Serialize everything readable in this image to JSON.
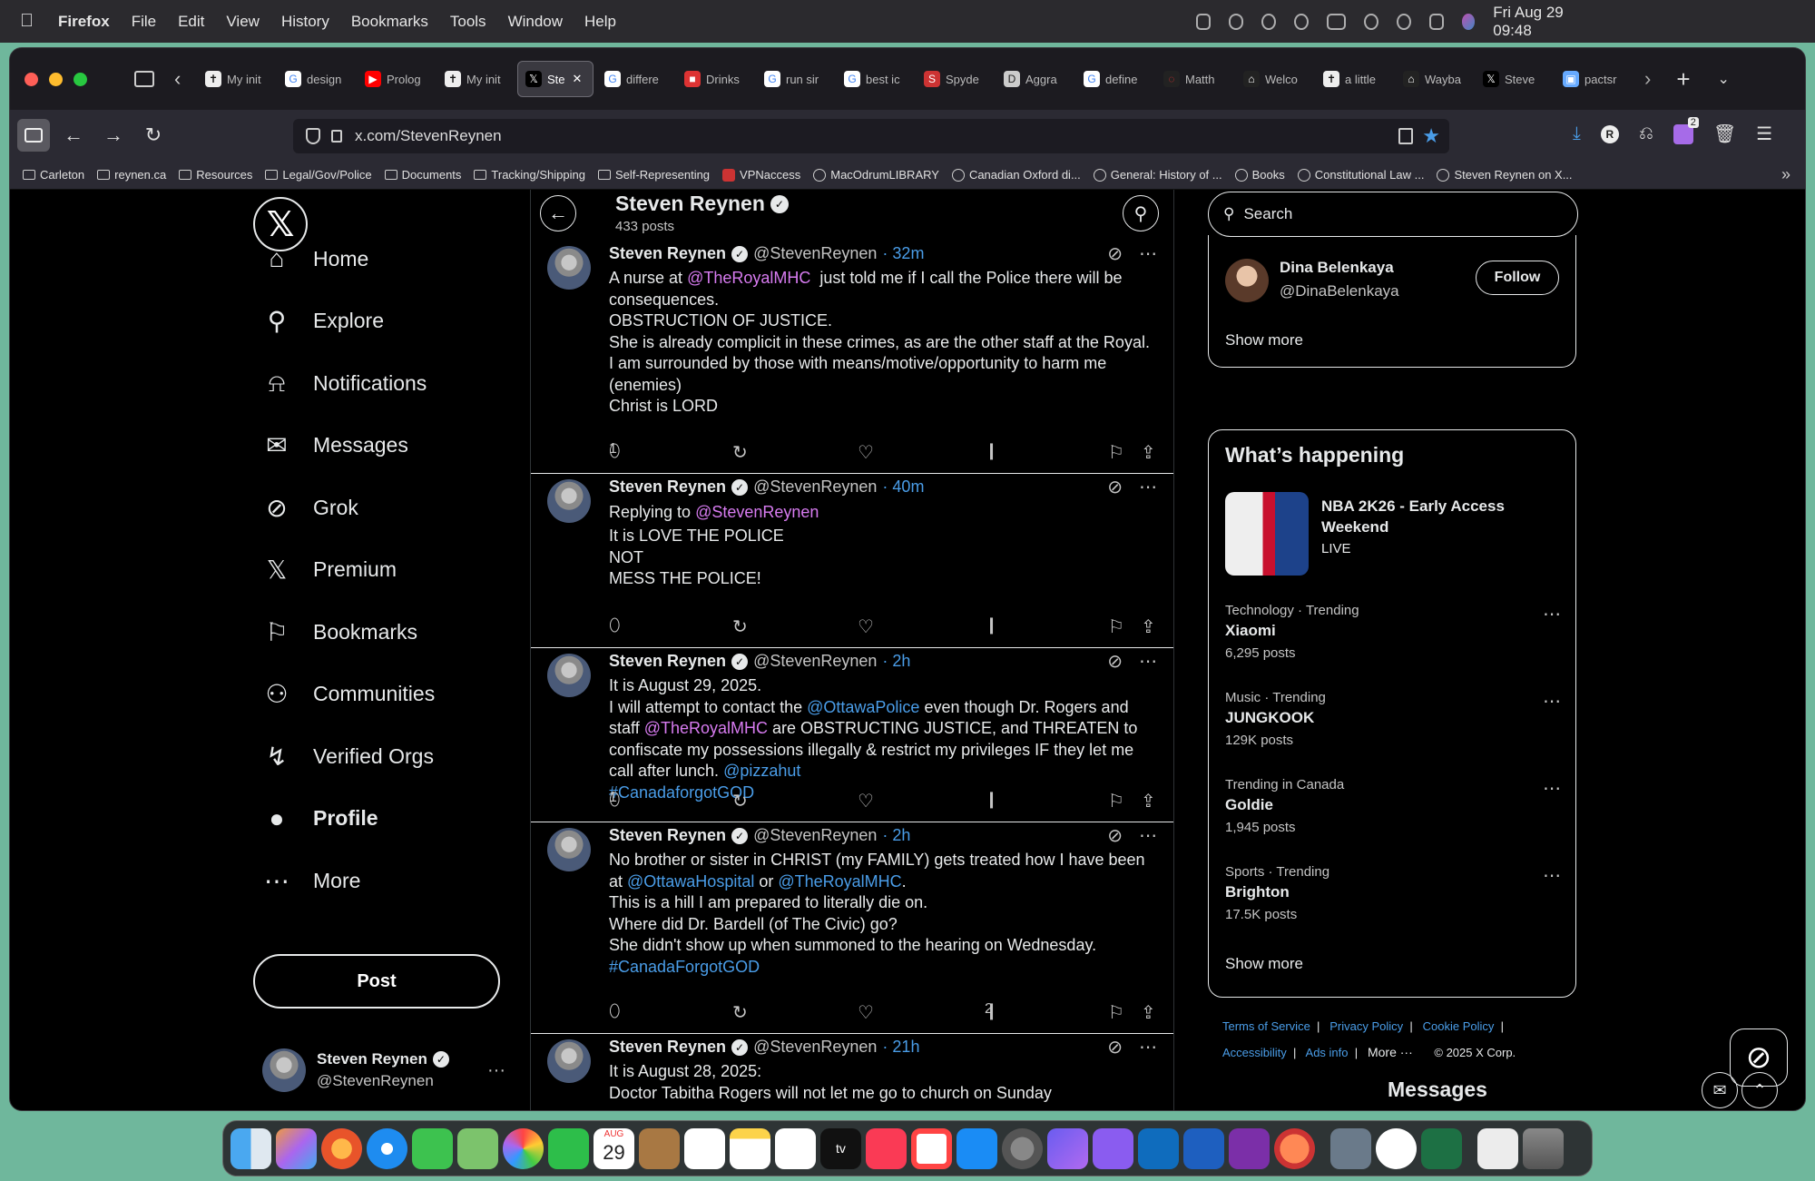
{
  "menubar": {
    "app": "Firefox",
    "items": [
      "File",
      "Edit",
      "View",
      "History",
      "Bookmarks",
      "Tools",
      "Window",
      "Help"
    ],
    "clock": "Fri Aug 29  09:48"
  },
  "tabs": [
    {
      "label": "My init",
      "icon": "cross"
    },
    {
      "label": "design",
      "icon": "google"
    },
    {
      "label": "Prolog",
      "icon": "youtube"
    },
    {
      "label": "My init",
      "icon": "cross"
    },
    {
      "label": "Ste",
      "icon": "x",
      "active": true
    },
    {
      "label": "differe",
      "icon": "google"
    },
    {
      "label": "Drinks",
      "icon": "red"
    },
    {
      "label": "run sir",
      "icon": "google"
    },
    {
      "label": "best ic",
      "icon": "google"
    },
    {
      "label": "Spyde",
      "icon": "spyder"
    },
    {
      "label": "Aggra",
      "icon": "dict"
    },
    {
      "label": "define",
      "icon": "google"
    },
    {
      "label": "Matth",
      "icon": "arc"
    },
    {
      "label": "Welco",
      "icon": "museum"
    },
    {
      "label": "a little",
      "icon": "cross"
    },
    {
      "label": "Wayba",
      "icon": "museum"
    },
    {
      "label": "Steve",
      "icon": "x"
    },
    {
      "label": "pactsr",
      "icon": "img"
    }
  ],
  "url": "x.com/StevenReynen",
  "ext_badge": "2",
  "bookmarks": [
    {
      "label": "Carleton",
      "type": "folder"
    },
    {
      "label": "reynen.ca",
      "type": "folder"
    },
    {
      "label": "Resources",
      "type": "folder"
    },
    {
      "label": "Legal/Gov/Police",
      "type": "folder"
    },
    {
      "label": "Documents",
      "type": "folder"
    },
    {
      "label": "Tracking/Shipping",
      "type": "folder"
    },
    {
      "label": "Self-Representing",
      "type": "folder"
    },
    {
      "label": "VPNaccess",
      "type": "site"
    },
    {
      "label": "MacOdrumLIBRARY",
      "type": "globe"
    },
    {
      "label": "Canadian Oxford di...",
      "type": "globe"
    },
    {
      "label": "General: History of ...",
      "type": "globe"
    },
    {
      "label": "Books",
      "type": "globe"
    },
    {
      "label": "Constitutional Law ...",
      "type": "globe"
    },
    {
      "label": "Steven Reynen on X...",
      "type": "globe"
    }
  ],
  "leftnav": {
    "items": [
      {
        "label": "Home",
        "icon": "home-icon"
      },
      {
        "label": "Explore",
        "icon": "search-icon"
      },
      {
        "label": "Notifications",
        "icon": "bell-icon"
      },
      {
        "label": "Messages",
        "icon": "mail-icon"
      },
      {
        "label": "Grok",
        "icon": "grok-icon"
      },
      {
        "label": "Premium",
        "icon": "x-icon"
      },
      {
        "label": "Bookmarks",
        "icon": "bookmark-icon"
      },
      {
        "label": "Communities",
        "icon": "communities-icon"
      },
      {
        "label": "Verified Orgs",
        "icon": "bolt-icon"
      },
      {
        "label": "Profile",
        "icon": "person-icon"
      },
      {
        "label": "More",
        "icon": "more-circle-icon"
      }
    ],
    "post": "Post",
    "account": {
      "name": "Steven Reynen",
      "handle": "@StevenReynen"
    }
  },
  "header": {
    "name": "Steven Reynen",
    "posts": "433 posts"
  },
  "tweets": [
    {
      "name": "Steven Reynen",
      "handle": "@StevenReynen",
      "time": "· 32m",
      "body": "A nurse at <a>@TheRoyalMHC</a>  just told me if I call the Police there will be\nconsequences.\nOBSTRUCTION OF JUSTICE.\nShe is already complicit in these crimes, as are the other staff at the Royal.\nI am surrounded by those with means/motive/opportunity to harm me\n(enemies)\nChrist is LORD",
      "replies": "1",
      "views": ""
    },
    {
      "name": "Steven Reynen",
      "handle": "@StevenReynen",
      "time": "· 40m",
      "reply_to": "@StevenReynen",
      "body": "It is LOVE THE POLICE\nNOT\nMESS THE POLICE!",
      "replies": "",
      "views": ""
    },
    {
      "name": "Steven Reynen",
      "handle": "@StevenReynen",
      "time": "· 2h",
      "body": "It is August 29, 2025.\nI will attempt to contact the <h>@OttawaPolice</h> even though Dr. Rogers and\nstaff <a>@TheRoyalMHC</a> are OBSTRUCTING JUSTICE, and THREATEN to\nconfiscate my possessions illegally & restrict my privileges IF they let me\ncall after lunch. <h>@pizzahut</h>\n<h>#CanadaforgotGOD</h>",
      "replies": "1",
      "views": ""
    },
    {
      "name": "Steven Reynen",
      "handle": "@StevenReynen",
      "time": "· 2h",
      "body": "No brother or sister in CHRIST (my FAMILY) gets treated how I have been\nat <h>@OttawaHospital</h> or <h>@TheRoyalMHC</h>.\nThis is a hill I am prepared to literally die on.\nWhere did Dr. Bardell (of The Civic) go?\nShe didn't show up when summoned to the hearing on Wednesday.\n<h>#CanadaForgotGOD</h>",
      "replies": "",
      "views": "2"
    },
    {
      "name": "Steven Reynen",
      "handle": "@StevenReynen",
      "time": "· 21h",
      "body": "It is August 28, 2025:\nDoctor Tabitha Rogers will not let me go to church on Sunday",
      "replies": "",
      "views": ""
    }
  ],
  "reply_prefix": "Replying to",
  "sidebar": {
    "search_placeholder": "Search",
    "who": {
      "name": "Dina Belenkaya",
      "handle": "@DinaBelenkaya",
      "follow": "Follow",
      "show_more": "Show more"
    },
    "happening": {
      "title": "What’s happening",
      "featured": {
        "title": "NBA 2K26 - Early Access Weekend",
        "status": "LIVE"
      },
      "trends": [
        {
          "category": "Technology · Trending",
          "name": "Xiaomi",
          "count": "6,295 posts"
        },
        {
          "category": "Music · Trending",
          "name": "JUNGKOOK",
          "count": "129K posts"
        },
        {
          "category": "Trending in Canada",
          "name": "Goldie",
          "count": "1,945 posts"
        },
        {
          "category": "Sports · Trending",
          "name": "Brighton",
          "count": "17.5K posts"
        }
      ],
      "show_more": "Show more"
    },
    "footer": {
      "links": [
        "Terms of Service",
        "Privacy Policy",
        "Cookie Policy",
        "Accessibility",
        "Ads info"
      ],
      "more": "More ···",
      "copyright": "© 2025 X Corp."
    },
    "messages": "Messages"
  },
  "dock": {
    "calendar_month": "AUG",
    "calendar_day": "29",
    "tv_label": "tv"
  }
}
